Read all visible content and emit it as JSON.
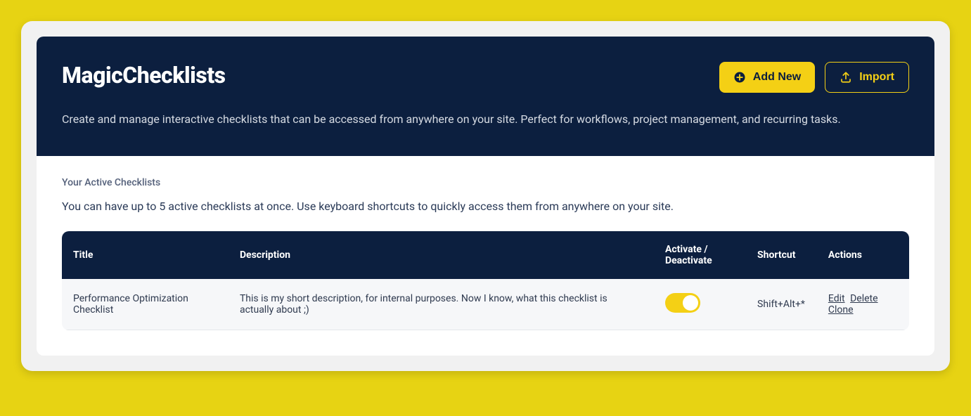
{
  "header": {
    "title": "MagicChecklists",
    "description": "Create and manage interactive checklists that can be accessed from anywhere on your site. Perfect for workflows, project management, and recurring tasks.",
    "add_button_label": "Add New",
    "import_button_label": "Import"
  },
  "section": {
    "label": "Your Active Checklists",
    "description": "You can have up to 5 active checklists at once. Use keyboard shortcuts to quickly access them from anywhere on your site."
  },
  "table": {
    "headers": {
      "title": "Title",
      "description": "Description",
      "toggle": "Activate / Deactivate",
      "shortcut": "Shortcut",
      "actions": "Actions"
    },
    "rows": [
      {
        "title": "Performance Optimization Checklist",
        "description": "This is my short description, for internal purposes. Now I know, what this checklist is actually about ;)",
        "active": true,
        "shortcut": "Shift+Alt+*",
        "actions": {
          "edit": "Edit",
          "delete": "Delete",
          "clone": "Clone"
        }
      }
    ]
  }
}
